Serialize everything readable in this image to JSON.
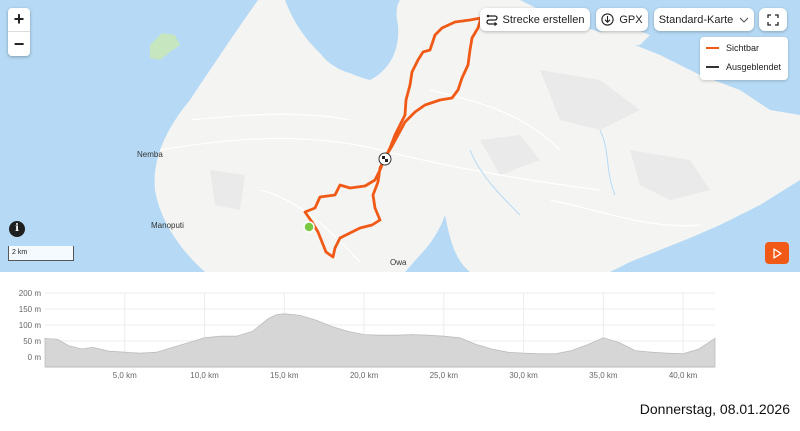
{
  "toolbar": {
    "create_route_label": "Strecke erstellen",
    "gpx_label": "GPX",
    "map_style_label": "Standard-Karte",
    "zoom_in_label": "+",
    "zoom_out_label": "−"
  },
  "legend": {
    "items": [
      {
        "label": "Sichtbar",
        "color": "#f15a16"
      },
      {
        "label": "Ausgeblendet",
        "color": "#333333"
      }
    ]
  },
  "map": {
    "places": [
      "Nemba",
      "Manoputi",
      "Owa"
    ],
    "scale_label": "2 km",
    "info_label": "i",
    "colors": {
      "water": "#b6daf5",
      "land": "#f4f4f2",
      "route": "#f15a16",
      "start": "#7ac943"
    }
  },
  "chart_data": {
    "type": "area",
    "x_unit": "km",
    "y_unit": "m",
    "xlim": [
      0,
      42
    ],
    "ylim": [
      0,
      200
    ],
    "x_ticks": [
      "5,0 km",
      "10,0 km",
      "15,0 km",
      "20,0 km",
      "25,0 km",
      "30,0 km",
      "35,0 km",
      "40,0 km"
    ],
    "x_tick_values": [
      5,
      10,
      15,
      20,
      25,
      30,
      35,
      40
    ],
    "y_ticks": [
      "200 m",
      "150 m",
      "100 m",
      "50 m",
      "0 m"
    ],
    "y_tick_values": [
      200,
      150,
      100,
      50,
      0
    ],
    "grid": true,
    "x": [
      0,
      0.8,
      1.5,
      2.3,
      3.0,
      4.0,
      5.0,
      6.0,
      7.0,
      8.0,
      9.0,
      10.0,
      11.0,
      12.0,
      13.0,
      14.0,
      14.5,
      15.0,
      16.0,
      17.0,
      18.0,
      19.0,
      20.0,
      21.0,
      22.0,
      23.0,
      24.0,
      25.0,
      26.0,
      27.0,
      28.0,
      29.0,
      30.0,
      31.0,
      32.0,
      33.0,
      34.0,
      35.0,
      36.0,
      37.0,
      38.0,
      39.0,
      40.0,
      41.0,
      42.0
    ],
    "y": [
      58,
      55,
      35,
      25,
      30,
      18,
      15,
      12,
      15,
      30,
      45,
      60,
      65,
      65,
      80,
      120,
      132,
      135,
      130,
      115,
      95,
      80,
      70,
      68,
      68,
      70,
      68,
      65,
      60,
      40,
      25,
      15,
      12,
      10,
      10,
      20,
      38,
      60,
      45,
      20,
      15,
      12,
      10,
      25,
      58
    ]
  },
  "footer": {
    "date": "Donnerstag, 08.01.2026"
  }
}
